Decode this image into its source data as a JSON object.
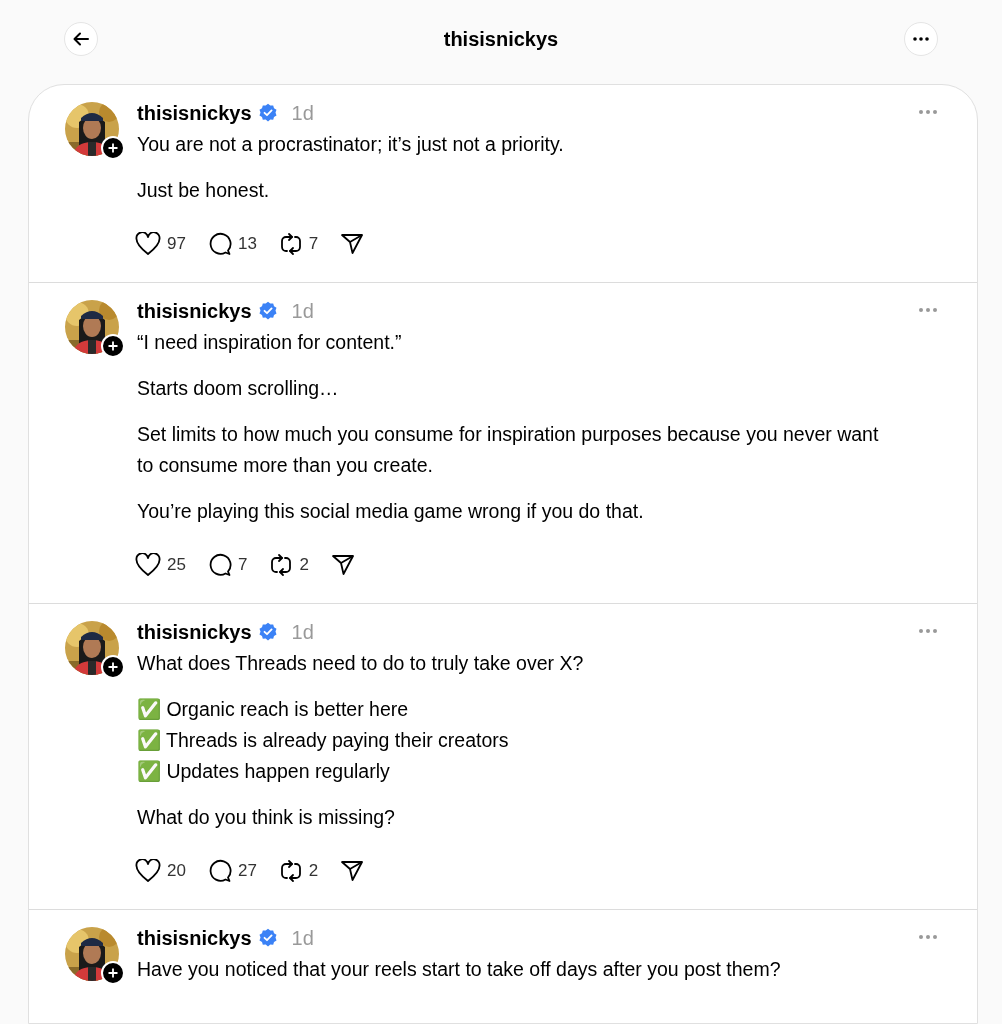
{
  "header": {
    "title": "thisisnickys"
  },
  "posts": [
    {
      "author": "thisisnickys",
      "verified": true,
      "time": "1d",
      "paragraphs": [
        [
          "You are not a procrastinator; it’s just not a priority."
        ],
        [
          "Just be honest."
        ]
      ],
      "likes": "97",
      "replies": "13",
      "reposts": "7"
    },
    {
      "author": "thisisnickys",
      "verified": true,
      "time": "1d",
      "paragraphs": [
        [
          "“I need inspiration for content.”"
        ],
        [
          "Starts doom scrolling…"
        ],
        [
          "Set limits to how much you consume for inspiration purposes because you never want to consume more than you create."
        ],
        [
          "You’re playing this social media game wrong if you do that."
        ]
      ],
      "likes": "25",
      "replies": "7",
      "reposts": "2"
    },
    {
      "author": "thisisnickys",
      "verified": true,
      "time": "1d",
      "paragraphs": [
        [
          "What does Threads need to do to truly take over X?"
        ],
        [
          "✅ Organic reach is better here",
          "✅ Threads is already paying their creators",
          "✅ Updates happen regularly"
        ],
        [
          "What do you think is missing?"
        ]
      ],
      "likes": "20",
      "replies": "27",
      "reposts": "2"
    },
    {
      "author": "thisisnickys",
      "verified": true,
      "time": "1d",
      "paragraphs": [
        [
          "Have you noticed that your reels start to take off days after you post them?"
        ]
      ]
    }
  ]
}
